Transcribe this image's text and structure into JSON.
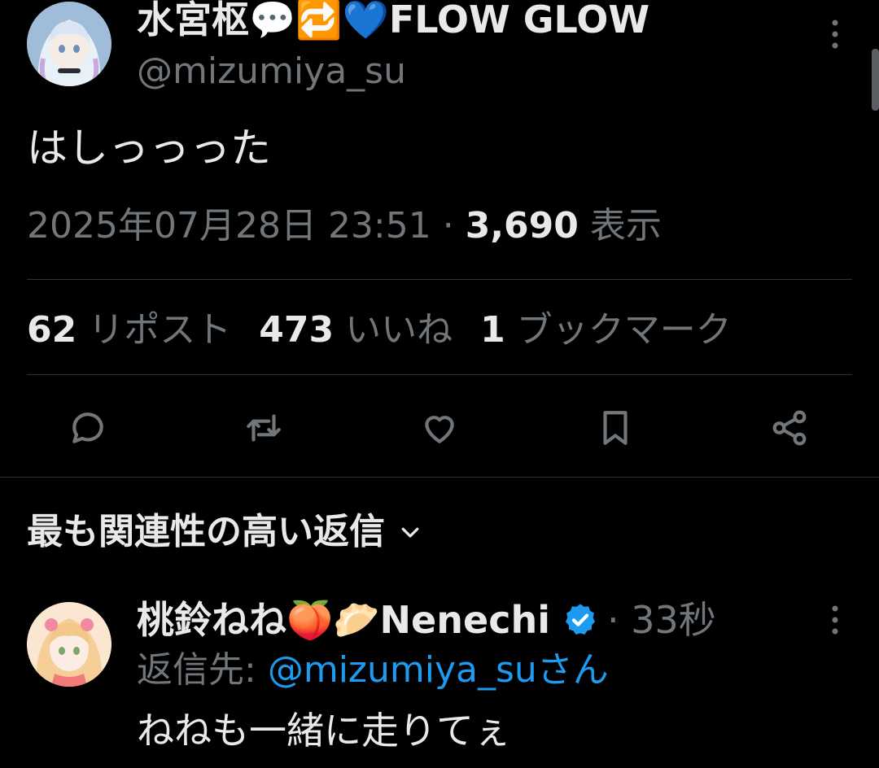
{
  "tweet": {
    "author": {
      "display_name": "水宮枢💬🔁💙FLOW GLOW",
      "handle": "@mizumiya_su"
    },
    "text": "はしっっった",
    "timestamp": "2025年07月28日 23:51",
    "separator": " · ",
    "views_count": "3,690",
    "views_label": " 表示",
    "stats": {
      "reposts": {
        "count": "62",
        "label": "リポスト"
      },
      "likes": {
        "count": "473",
        "label": "いいね"
      },
      "bookmarks": {
        "count": "1",
        "label": "ブックマーク"
      }
    },
    "actions": [
      "reply-icon",
      "repost-icon",
      "like-icon",
      "bookmark-icon",
      "share-icon"
    ]
  },
  "replies_section": {
    "sort_label": "最も関連性の高い返信",
    "replies": [
      {
        "display_name": "桃鈴ねね🍑🥟Nenechi",
        "verified": true,
        "time": "· 33秒",
        "reply_to_prefix": "返信先:",
        "reply_to_mention": "@mizumiya_suさん",
        "text": "ねねも一緒に走りてぇ"
      }
    ]
  },
  "colors": {
    "background": "#000000",
    "primary_text": "#e7e9ea",
    "secondary_text": "#71767b",
    "divider": "#2f3336",
    "accent": "#1d9bf0"
  }
}
